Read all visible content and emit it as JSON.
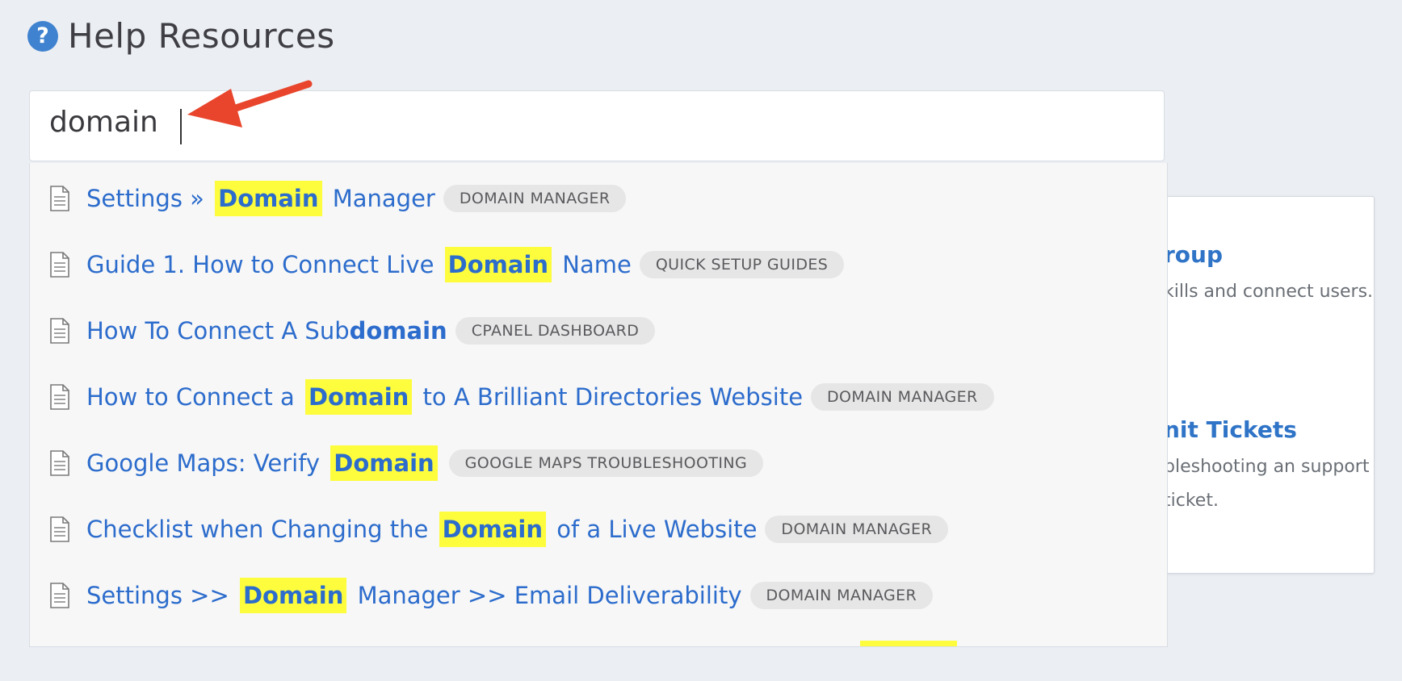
{
  "header": {
    "title": "Help Resources",
    "icon": "question-circle-icon"
  },
  "search": {
    "value": "domain"
  },
  "side_card": {
    "item1_title": "roup",
    "item1_desc": "kills and connect users.",
    "item2_title": "nit Tickets",
    "item2_desc": "bleshooting an support ticket."
  },
  "results": [
    {
      "pre": "Settings » ",
      "hl": "Domain",
      "post": " Manager",
      "badge": "DOMAIN MANAGER"
    },
    {
      "pre": "Guide 1. How to Connect Live ",
      "hl": "Domain",
      "post": " Name",
      "badge": "QUICK SETUP GUIDES"
    },
    {
      "pre": "How To Connect A Sub",
      "bold": "domain",
      "badge": "CPANEL DASHBOARD"
    },
    {
      "pre": "How to Connect a ",
      "hl": "Domain",
      "post": " to A Brilliant Directories Website",
      "badge": "DOMAIN MANAGER"
    },
    {
      "pre": "Google Maps: Verify ",
      "hl": "Domain",
      "badge": "GOOGLE MAPS TROUBLESHOOTING"
    },
    {
      "pre": "Checklist when Changing the ",
      "hl": "Domain",
      "post": " of a Live Website",
      "badge": "DOMAIN MANAGER"
    },
    {
      "pre": "Settings >> ",
      "hl": "Domain",
      "post": " Manager >> Email Deliverability",
      "badge": "DOMAIN MANAGER"
    }
  ],
  "colors": {
    "accent": "#2c6ccc",
    "highlight": "#fdfd3e",
    "arrow": "#e8452c"
  }
}
